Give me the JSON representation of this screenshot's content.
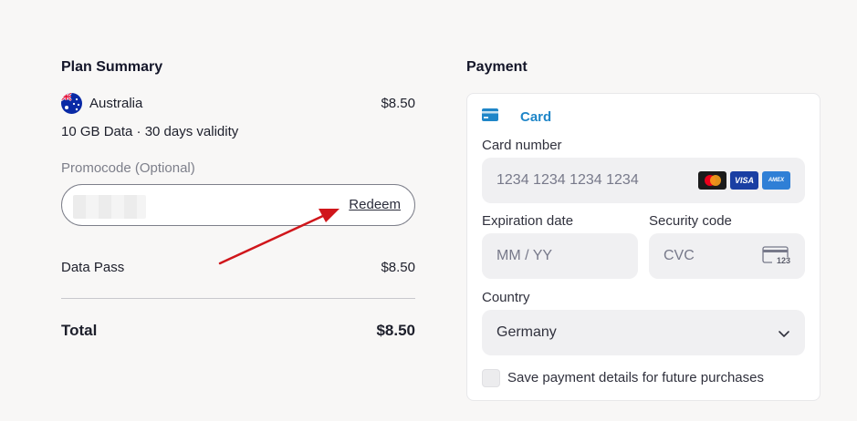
{
  "plan_summary": {
    "title": "Plan Summary",
    "country": "Australia",
    "country_price": "$8.50",
    "plan_details": "10 GB Data · 30 days validity",
    "promo_label": "Promocode (Optional)",
    "redeem_label": "Redeem",
    "data_pass_label": "Data Pass",
    "data_pass_price": "$8.50",
    "total_label": "Total",
    "total_price": "$8.50"
  },
  "payment": {
    "title": "Payment",
    "tab_label": "Card",
    "card_number_label": "Card number",
    "card_number_placeholder": "1234 1234 1234 1234",
    "brands": [
      "mastercard-icon",
      "visa-icon",
      "amex-icon"
    ],
    "visa_text": "VISA",
    "amex_text": "AMEX",
    "expiry_label": "Expiration date",
    "expiry_placeholder": "MM / YY",
    "cvc_label": "Security code",
    "cvc_placeholder": "CVC",
    "cvc_icon_text": "123",
    "country_label": "Country",
    "country_value": "Germany",
    "save_label": "Save payment details for future purchases"
  },
  "colors": {
    "accent": "#1f86c8",
    "arrow": "#d0161b",
    "background": "#f8f7f6"
  }
}
